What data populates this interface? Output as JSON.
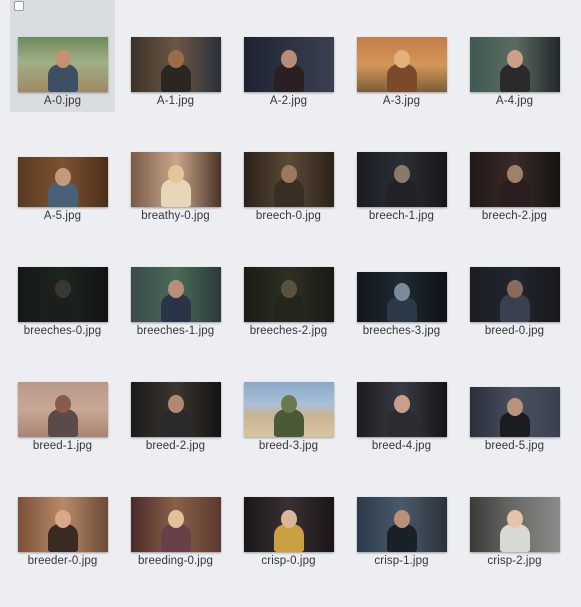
{
  "browser": {
    "items": [
      {
        "name": "A-0.jpg",
        "selected": true,
        "bg": "linear-gradient(180deg,#6d8a5a 0%,#9fb087 45%,#a08866 100%)",
        "fig": "#3d4f63",
        "head": "#c4926e",
        "aspect": "ar169"
      },
      {
        "name": "A-1.jpg",
        "selected": false,
        "bg": "linear-gradient(90deg,#3a3228 0%,#6b5745 50%,#2a2f3a 100%)",
        "fig": "#2b2620",
        "head": "#9d6a4a",
        "aspect": "ar169"
      },
      {
        "name": "A-2.jpg",
        "selected": false,
        "bg": "linear-gradient(90deg,#1e2230 0%,#2f3443 55%,#3a3f52 100%)",
        "fig": "#2a2024",
        "head": "#b98c76",
        "aspect": "ar169"
      },
      {
        "name": "A-3.jpg",
        "selected": false,
        "bg": "linear-gradient(180deg,#c27c4a 0%,#d59758 50%,#7a5e3a 100%)",
        "fig": "#7a4a2a",
        "head": "#e2b27a",
        "aspect": "ar169"
      },
      {
        "name": "A-4.jpg",
        "selected": false,
        "bg": "linear-gradient(90deg,#3e5a52 0%,#5c6a60 50%,#22282a 100%)",
        "fig": "#2a2a2a",
        "head": "#c9a088",
        "aspect": "ar169"
      },
      {
        "name": "A-5.jpg",
        "selected": false,
        "bg": "linear-gradient(90deg,#5a3a22 0%,#7c5230 50%,#4a2e1a 100%)",
        "fig": "#4a6078",
        "head": "#c49a7a",
        "aspect": "ar169"
      },
      {
        "name": "breathy-0.jpg",
        "selected": false,
        "bg": "linear-gradient(90deg,#7a5a48 0%,#c8a88a 50%,#4a3428 100%)",
        "fig": "#e8d6b8",
        "head": "#e6c49a",
        "aspect": "ar169"
      },
      {
        "name": "breech-0.jpg",
        "selected": false,
        "bg": "linear-gradient(90deg,#2a2018 0%,#5a4a38 50%,#2a2218 100%)",
        "fig": "#3a2e24",
        "head": "#9a7a5e",
        "aspect": "ar169"
      },
      {
        "name": "breech-1.jpg",
        "selected": false,
        "bg": "linear-gradient(90deg,#1a1c22 0%,#2c2e36 50%,#15161a 100%)",
        "fig": "#202228",
        "head": "#8a7a6a",
        "aspect": "ar169"
      },
      {
        "name": "breech-2.jpg",
        "selected": false,
        "bg": "linear-gradient(90deg,#201818 0%,#3a2a28 50%,#151212 100%)",
        "fig": "#2a1e1e",
        "head": "#a0806a",
        "aspect": "ar169"
      },
      {
        "name": "breeches-0.jpg",
        "selected": false,
        "bg": "linear-gradient(90deg,#141816 0%,#1e2420 50%,#111412 100%)",
        "fig": "#1a1e1c",
        "head": "#3a3632",
        "aspect": "ar169"
      },
      {
        "name": "breeches-1.jpg",
        "selected": false,
        "bg": "linear-gradient(90deg,#3a4a4a 0%,#4a6a58 50%,#2a3a38 100%)",
        "fig": "#2a3448",
        "head": "#b89078",
        "aspect": "ar169"
      },
      {
        "name": "breeches-2.jpg",
        "selected": false,
        "bg": "linear-gradient(90deg,#1a1c16 0%,#2e3024 50%,#181a14 100%)",
        "fig": "#24261c",
        "head": "#5a5240",
        "aspect": "ar169"
      },
      {
        "name": "breeches-3.jpg",
        "selected": false,
        "bg": "linear-gradient(90deg,#12161c 0%,#1e2a34 50%,#0e1116 100%)",
        "fig": "#2a3848",
        "head": "#7a8a98",
        "aspect": "ar169"
      },
      {
        "name": "breed-0.jpg",
        "selected": false,
        "bg": "linear-gradient(90deg,#1a1c22 0%,#22262e 50%,#16181c 100%)",
        "fig": "#3a4050",
        "head": "#8a6a5a",
        "aspect": "ar169"
      },
      {
        "name": "breed-1.jpg",
        "selected": false,
        "bg": "linear-gradient(180deg,#b8988a 0%,#c8a894 50%,#a88472 100%)",
        "fig": "#5a4a48",
        "head": "#8a5a4a",
        "aspect": "ar169"
      },
      {
        "name": "breed-2.jpg",
        "selected": false,
        "bg": "linear-gradient(90deg,#1a1a1a 0%,#3a3630 50%,#141414 100%)",
        "fig": "#2a2a2a",
        "head": "#b08a70",
        "aspect": "ar169"
      },
      {
        "name": "breed-3.jpg",
        "selected": false,
        "bg": "linear-gradient(180deg,#8aa8c8 0%,#a8c0d8 40%,#c8b494 60%,#d8c4a0 100%)",
        "fig": "#4a5a38",
        "head": "#6a7a4a",
        "aspect": "ar169"
      },
      {
        "name": "breed-4.jpg",
        "selected": false,
        "bg": "linear-gradient(90deg,#1a1c20 0%,#3a3c44 50%,#121418 100%)",
        "fig": "#2a2c30",
        "head": "#c8a08a",
        "aspect": "ar169"
      },
      {
        "name": "breed-5.jpg",
        "selected": false,
        "bg": "linear-gradient(90deg,#2a2e3a 0%,#4a5060 50%,#3a4050 100%)",
        "fig": "#1a1c22",
        "head": "#b89478",
        "aspect": "ar169"
      },
      {
        "name": "breeder-0.jpg",
        "selected": false,
        "bg": "linear-gradient(90deg,#7a5038 0%,#b88a68 50%,#6a4a38 100%)",
        "fig": "#3a2a24",
        "head": "#d8a888",
        "aspect": "ar169"
      },
      {
        "name": "breeding-0.jpg",
        "selected": false,
        "bg": "linear-gradient(90deg,#4a2a2a 0%,#8a6048 50%,#5a3830 100%)",
        "fig": "#6a4048",
        "head": "#e2c09a",
        "aspect": "ar169"
      },
      {
        "name": "crisp-0.jpg",
        "selected": false,
        "bg": "linear-gradient(90deg,#1a1618 0%,#3a3034 50%,#1a1416 100%)",
        "fig": "#c8a040",
        "head": "#d8b898",
        "aspect": "ar169"
      },
      {
        "name": "crisp-1.jpg",
        "selected": false,
        "bg": "linear-gradient(90deg,#2a3a4a 0%,#4a5a6a 50%,#2a323a 100%)",
        "fig": "#1a2028",
        "head": "#b89078",
        "aspect": "ar169"
      },
      {
        "name": "crisp-2.jpg",
        "selected": false,
        "bg": "linear-gradient(90deg,#3a3a38 0%,#6a6a66 50%,#8a8a88 100%)",
        "fig": "#d8d8d4",
        "head": "#e4c4a8",
        "aspect": "ar169"
      }
    ]
  }
}
